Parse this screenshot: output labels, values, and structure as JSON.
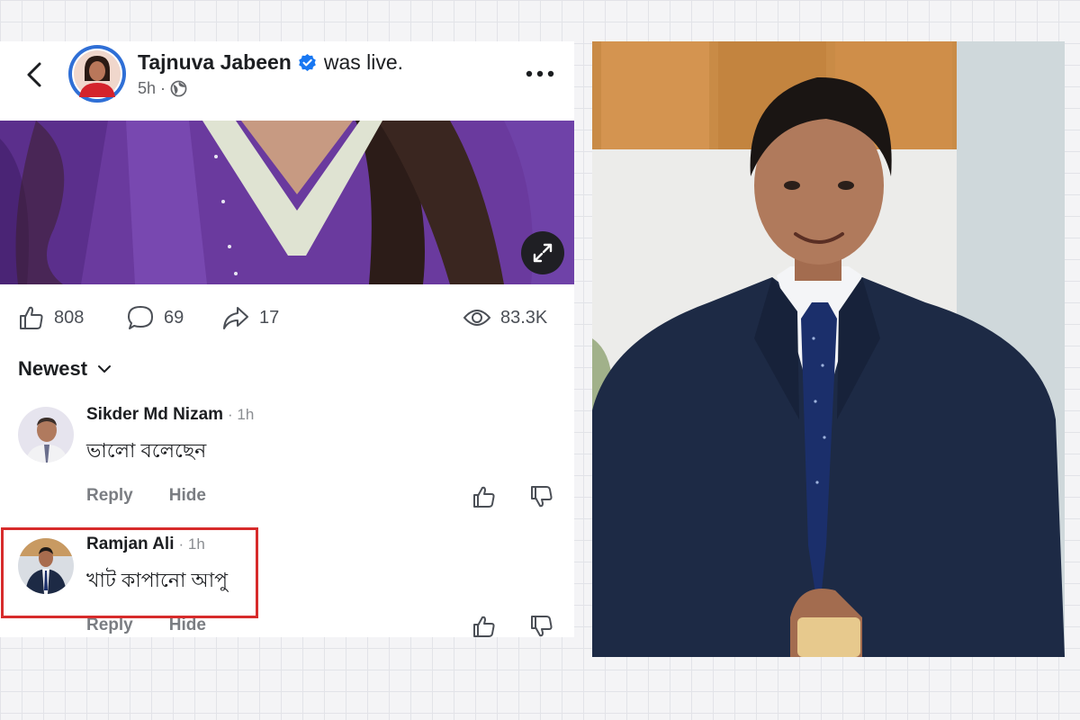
{
  "post": {
    "author": "Tajnuva Jabeen",
    "status": "was live.",
    "time": "5h",
    "dot": "·",
    "privacy_icon": "globe-icon",
    "verified_icon": "verified-badge-icon"
  },
  "stats": {
    "likes": "808",
    "comments": "69",
    "shares": "17",
    "views": "83.3K"
  },
  "comments_section": {
    "sort_label": "Newest"
  },
  "comments": [
    {
      "author": "Sikder Md Nizam",
      "time": "· 1h",
      "text": "ভালো বলেছেন",
      "reply_label": "Reply",
      "hide_label": "Hide"
    },
    {
      "author": "Ramjan Ali",
      "time": "· 1h",
      "text": "খাট কাপানো আপু",
      "reply_label": "Reply",
      "hide_label": "Hide"
    }
  ],
  "colors": {
    "highlight_border": "#d72b2b",
    "verified_blue": "#1877f2",
    "avatar_ring": "#2f6fd6",
    "video_purple": "#6a3a9e"
  }
}
